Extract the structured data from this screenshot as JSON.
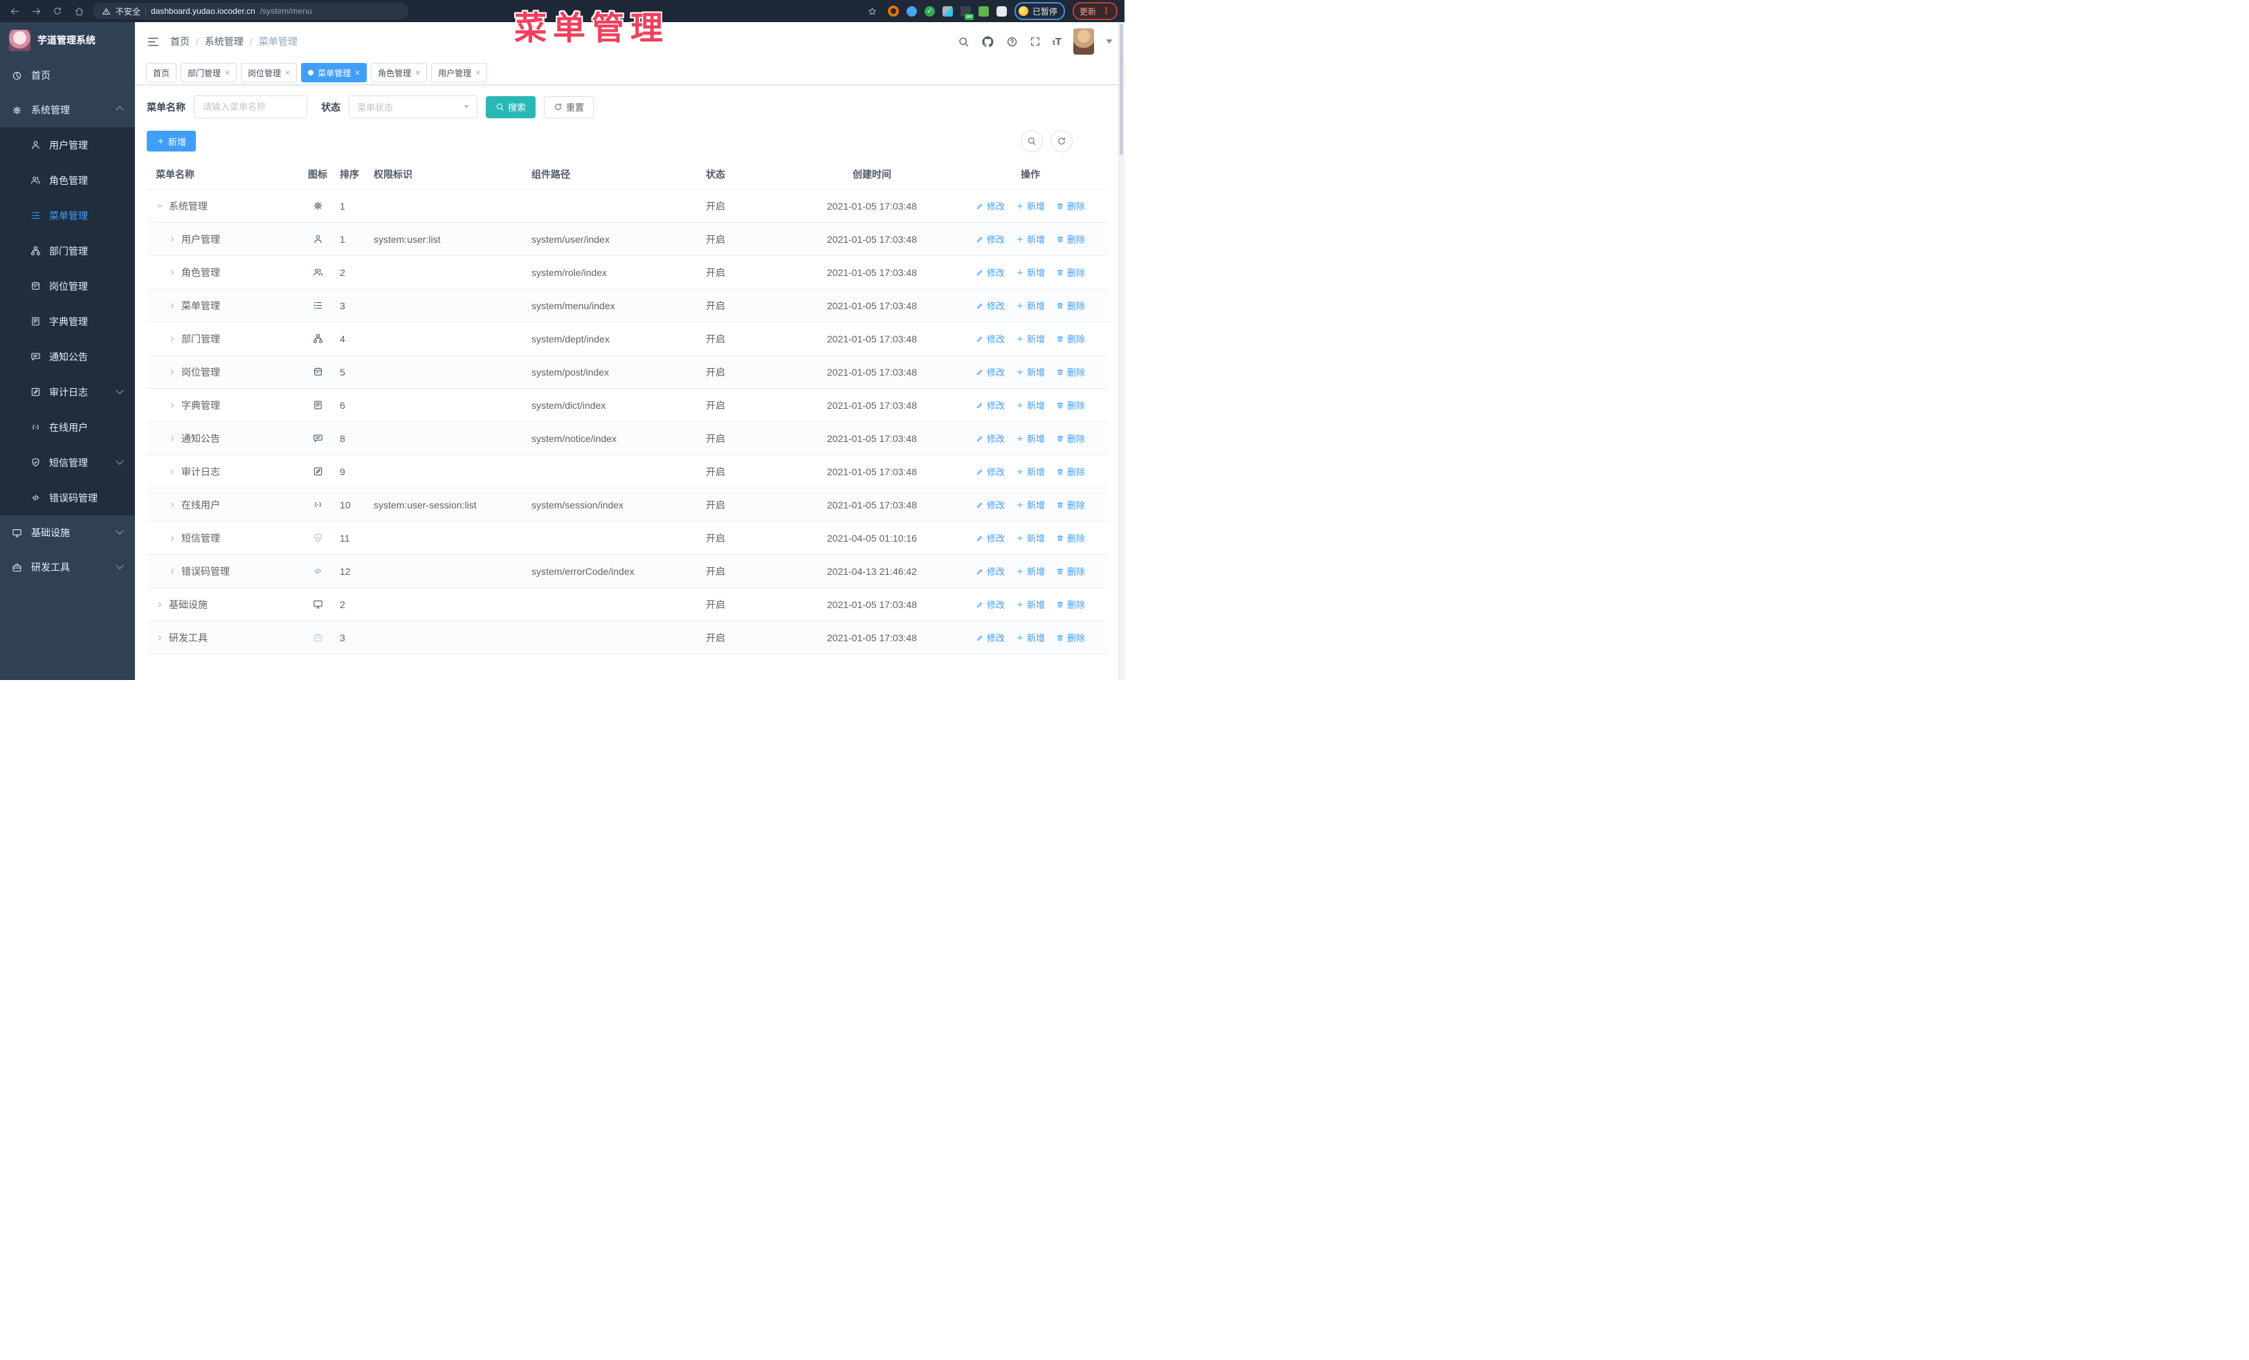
{
  "browser": {
    "security_label": "不安全",
    "url_host": "dashboard.yudao.iocoder.cn",
    "url_path": "/system/menu",
    "extension_icons": [
      "ring-icon",
      "pin-icon",
      "check-icon",
      "grid-icon",
      "list-on-icon",
      "robot-icon",
      "puzzle-icon"
    ],
    "on_badge": "on",
    "paused_badge": "已暂停",
    "update_button": "更新"
  },
  "overlay": {
    "title": "菜单管理"
  },
  "sidebar": {
    "logo_title": "芋道管理系统",
    "menu": [
      {
        "label": "首页",
        "icon": "home",
        "type": "root"
      },
      {
        "label": "系统管理",
        "icon": "gear",
        "type": "root",
        "arrow": "up"
      },
      {
        "label": "用户管理",
        "icon": "user",
        "type": "sub"
      },
      {
        "label": "角色管理",
        "icon": "users",
        "type": "sub"
      },
      {
        "label": "菜单管理",
        "icon": "menu",
        "type": "sub",
        "active": true
      },
      {
        "label": "部门管理",
        "icon": "tree",
        "type": "sub"
      },
      {
        "label": "岗位管理",
        "icon": "badge",
        "type": "sub"
      },
      {
        "label": "字典管理",
        "icon": "book",
        "type": "sub"
      },
      {
        "label": "通知公告",
        "icon": "message",
        "type": "sub"
      },
      {
        "label": "审计日志",
        "icon": "edit",
        "type": "sub",
        "arrow": "down"
      },
      {
        "label": "在线用户",
        "icon": "link",
        "type": "sub"
      },
      {
        "label": "短信管理",
        "icon": "shield",
        "type": "sub",
        "arrow": "down"
      },
      {
        "label": "错误码管理",
        "icon": "code",
        "type": "sub"
      },
      {
        "label": "基础设施",
        "icon": "monitor",
        "type": "root",
        "arrow": "down"
      },
      {
        "label": "研发工具",
        "icon": "tool",
        "type": "root",
        "arrow": "down"
      }
    ]
  },
  "header": {
    "breadcrumb": [
      "首页",
      "系统管理",
      "菜单管理"
    ]
  },
  "tabs": [
    {
      "label": "首页",
      "closable": false,
      "active": false
    },
    {
      "label": "部门管理",
      "closable": true,
      "active": false
    },
    {
      "label": "岗位管理",
      "closable": true,
      "active": false
    },
    {
      "label": "菜单管理",
      "closable": true,
      "active": true
    },
    {
      "label": "角色管理",
      "closable": true,
      "active": false
    },
    {
      "label": "用户管理",
      "closable": true,
      "active": false
    }
  ],
  "filters": {
    "name_label": "菜单名称",
    "name_placeholder": "请输入菜单名称",
    "status_label": "状态",
    "status_placeholder": "菜单状态",
    "search_label": "搜索",
    "reset_label": "重置"
  },
  "toolbar": {
    "add_label": "新增"
  },
  "table": {
    "columns": [
      "菜单名称",
      "图标",
      "排序",
      "权限标识",
      "组件路径",
      "状态",
      "创建时间",
      "操作"
    ],
    "actions": {
      "edit": "修改",
      "add": "新增",
      "delete": "删除"
    },
    "rows": [
      {
        "name": "系统管理",
        "level": 0,
        "expanded": true,
        "icon": "gear",
        "sort": "1",
        "perm": "",
        "path": "",
        "status": "开启",
        "time": "2021-01-05 17:03:48"
      },
      {
        "name": "用户管理",
        "level": 1,
        "expanded": false,
        "icon": "user",
        "sort": "1",
        "perm": "system:user:list",
        "path": "system/user/index",
        "status": "开启",
        "time": "2021-01-05 17:03:48"
      },
      {
        "name": "角色管理",
        "level": 1,
        "expanded": false,
        "icon": "users",
        "sort": "2",
        "perm": "",
        "path": "system/role/index",
        "status": "开启",
        "time": "2021-01-05 17:03:48"
      },
      {
        "name": "菜单管理",
        "level": 1,
        "expanded": false,
        "icon": "menu",
        "sort": "3",
        "perm": "",
        "path": "system/menu/index",
        "status": "开启",
        "time": "2021-01-05 17:03:48"
      },
      {
        "name": "部门管理",
        "level": 1,
        "expanded": false,
        "icon": "tree",
        "sort": "4",
        "perm": "",
        "path": "system/dept/index",
        "status": "开启",
        "time": "2021-01-05 17:03:48"
      },
      {
        "name": "岗位管理",
        "level": 1,
        "expanded": false,
        "icon": "badge",
        "sort": "5",
        "perm": "",
        "path": "system/post/index",
        "status": "开启",
        "time": "2021-01-05 17:03:48"
      },
      {
        "name": "字典管理",
        "level": 1,
        "expanded": false,
        "icon": "book",
        "sort": "6",
        "perm": "",
        "path": "system/dict/index",
        "status": "开启",
        "time": "2021-01-05 17:03:48"
      },
      {
        "name": "通知公告",
        "level": 1,
        "expanded": false,
        "icon": "message",
        "sort": "8",
        "perm": "",
        "path": "system/notice/index",
        "status": "开启",
        "time": "2021-01-05 17:03:48"
      },
      {
        "name": "审计日志",
        "level": 1,
        "expanded": false,
        "icon": "edit",
        "sort": "9",
        "perm": "",
        "path": "",
        "status": "开启",
        "time": "2021-01-05 17:03:48"
      },
      {
        "name": "在线用户",
        "level": 1,
        "expanded": false,
        "icon": "link",
        "sort": "10",
        "perm": "system:user-session:list",
        "path": "system/session/index",
        "status": "开启",
        "time": "2021-01-05 17:03:48"
      },
      {
        "name": "短信管理",
        "level": 1,
        "expanded": false,
        "icon": "shield",
        "sort": "11",
        "perm": "",
        "path": "",
        "status": "开启",
        "time": "2021-04-05 01:10:16"
      },
      {
        "name": "错误码管理",
        "level": 1,
        "expanded": false,
        "icon": "code",
        "sort": "12",
        "perm": "",
        "path": "system/errorCode/index",
        "status": "开启",
        "time": "2021-04-13 21:46:42"
      },
      {
        "name": "基础设施",
        "level": 0,
        "expanded": false,
        "icon": "monitor",
        "sort": "2",
        "perm": "",
        "path": "",
        "status": "开启",
        "time": "2021-01-05 17:03:48"
      },
      {
        "name": "研发工具",
        "level": 0,
        "expanded": false,
        "icon": "tool",
        "sort": "3",
        "perm": "",
        "path": "",
        "status": "开启",
        "time": "2021-01-05 17:03:48"
      }
    ]
  },
  "colors": {
    "primary": "#409eff",
    "search_teal": "#2ab8b5",
    "overlay_red": "#f23f5d",
    "sidebar_bg": "#304156",
    "submenu_bg": "#1f2d3d",
    "topbar_bg": "#1e2836"
  }
}
